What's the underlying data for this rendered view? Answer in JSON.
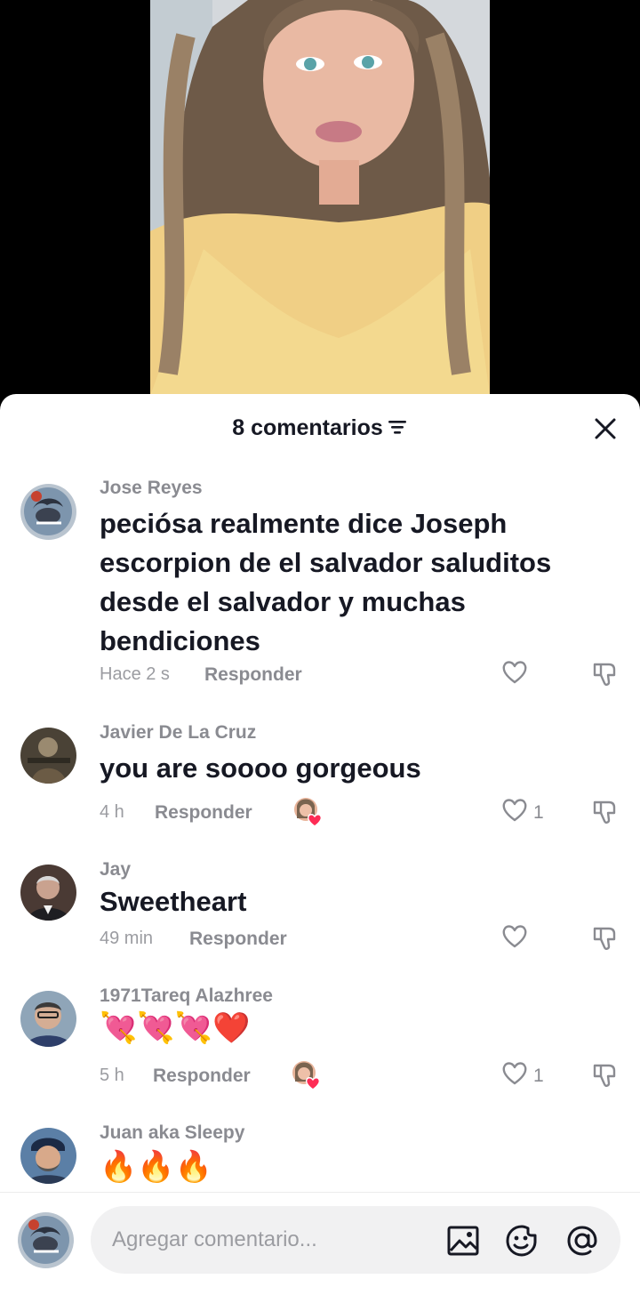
{
  "header": {
    "comment_count_label": "8 comentarios"
  },
  "comments": [
    {
      "username": "Jose Reyes",
      "text": "peciósa realmente dice Joseph escorpion de el salvador saluditos desde el salvador y muchas bendiciones",
      "time": "Hace 2 s",
      "reply_label": "Responder",
      "likes": "",
      "creator_liked": false
    },
    {
      "username": "Javier De La Cruz",
      "text": "you are soooo gorgeous",
      "time": "4 h",
      "reply_label": "Responder",
      "likes": "1",
      "creator_liked": true
    },
    {
      "username": "Jay",
      "text": "Sweetheart",
      "time": "49 min",
      "reply_label": "Responder",
      "likes": "",
      "creator_liked": false
    },
    {
      "username": "1971Tareq Alazhree",
      "text": "💘💘💘❤️",
      "time": "5 h",
      "reply_label": "Responder",
      "likes": "1",
      "creator_liked": true
    },
    {
      "username": "Juan aka Sleepy",
      "text": "🔥🔥🔥",
      "time": "",
      "reply_label": "",
      "likes": "",
      "creator_liked": false
    }
  ],
  "input": {
    "placeholder": "Agregar comentario..."
  },
  "icons": {
    "filter": "filter-icon",
    "close": "close-icon",
    "like": "heart-outline-icon",
    "dislike": "thumbs-down-icon",
    "image": "image-icon",
    "sticker": "emoji-sticker-icon",
    "mention": "at-mention-icon"
  },
  "colors": {
    "text_primary": "#161823",
    "text_secondary": "#8a8b91",
    "like_pink": "#fe2c55",
    "sheet_bg": "#ffffff",
    "input_bg": "#f1f1f2"
  }
}
